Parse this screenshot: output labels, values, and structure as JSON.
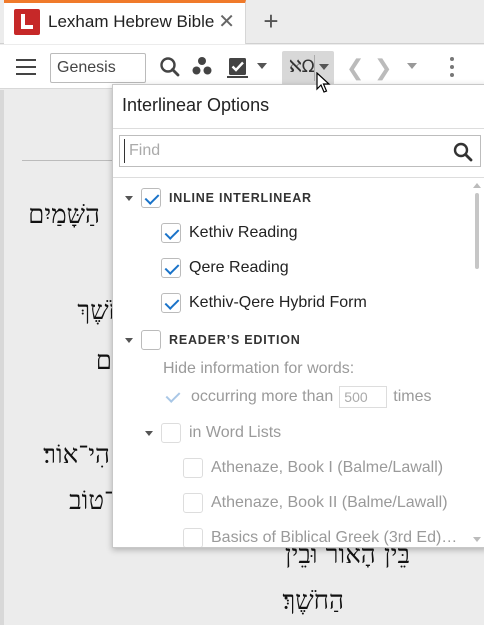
{
  "tab": {
    "title": "Lexham Hebrew Bible",
    "close_glyph": "✕",
    "add_glyph": "+"
  },
  "toolbar": {
    "reference": "Genesis",
    "interlinear_symbol": "ℵΩ",
    "back_glyph": "❮",
    "forward_glyph": "❯"
  },
  "document": {
    "lines": [
      "הַשָּׁמַיִם",
      "חֹשֶׁךְ",
      "ם",
      "הִי־אוֹר׃",
      "־טוֹב",
      "בֵּין הָאוֹר וּבֵין",
      "הַחֹשֶׁךְ׃"
    ]
  },
  "popup": {
    "title": "Interlinear Options",
    "find_placeholder": "Find",
    "sections": {
      "inline_interlinear": {
        "label": "INLINE INTERLINEAR",
        "checked": true,
        "items": [
          {
            "label": "Kethiv Reading",
            "checked": true
          },
          {
            "label": "Qere Reading",
            "checked": true
          },
          {
            "label": "Kethiv-Qere Hybrid Form",
            "checked": true
          }
        ]
      },
      "readers_edition": {
        "label": "READER’S EDITION",
        "checked": false,
        "hide_info_label": "Hide information for words:",
        "occurring_label": "occurring more than",
        "occurring_value": "500",
        "times_label": "times",
        "word_lists_label": "in Word Lists",
        "word_lists": [
          "Athenaze, Book I (Balme/Lawall)",
          "Athenaze, Book II (Balme/Lawall)",
          "Basics of Biblical Greek (3rd Ed)…"
        ]
      }
    }
  },
  "colors": {
    "accent_tab": "#f07a2a",
    "logo": "#c62828",
    "check": "#1a73c9"
  }
}
